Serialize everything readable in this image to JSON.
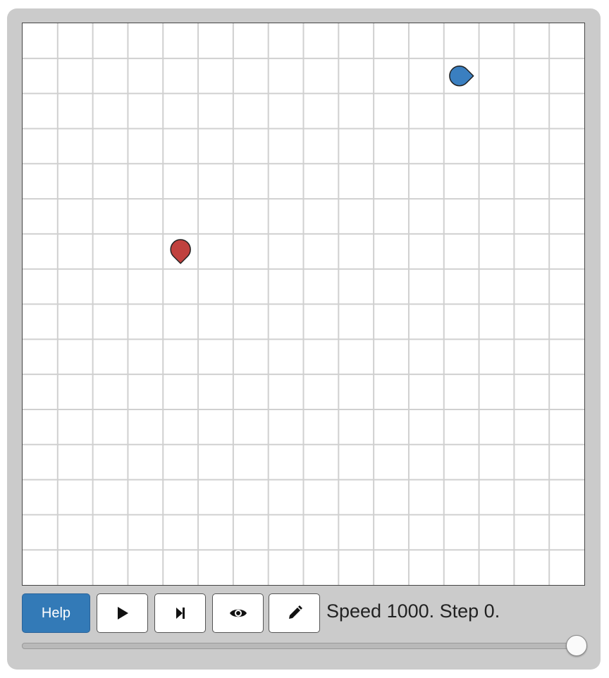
{
  "controls": {
    "help_label": "Help",
    "play_icon": "play-icon",
    "step_icon": "step-forward-icon",
    "view_icon": "eye-icon",
    "edit_icon": "pencil-icon"
  },
  "status": {
    "text": "Speed 1000. Step 0."
  },
  "speed_slider": {
    "value_fraction": 1.0
  },
  "board": {
    "columns": 16,
    "rows": 16,
    "grid_line_color": "#d0d0d0",
    "agents": [
      {
        "name": "blue-agent",
        "color": "#3a7fc0",
        "col": 12,
        "row": 1,
        "facing": "right"
      },
      {
        "name": "red-agent",
        "color": "#c0413e",
        "col": 4,
        "row": 6,
        "facing": "down"
      }
    ]
  }
}
